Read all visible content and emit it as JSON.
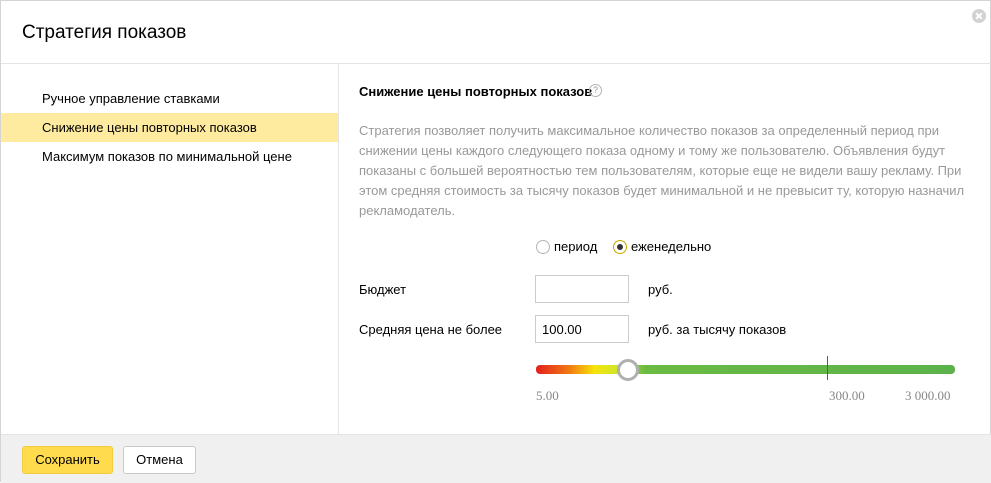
{
  "dialog": {
    "title": "Стратегия показов",
    "close_icon": "close-icon"
  },
  "sidebar": {
    "items": [
      {
        "label": "Ручное управление ставками",
        "active": false
      },
      {
        "label": "Снижение цены повторных показов",
        "active": true
      },
      {
        "label": "Максимум показов по минимальной цене",
        "active": false
      }
    ]
  },
  "content": {
    "section_title": "Снижение цены повторных показов",
    "help_icon": "?",
    "description": "Стратегия позволяет получить максимальное количество показов за определенный период при снижении цены каждого следующего показа одному и тому же пользователю. Объявления будут показаны с большей вероятностью тем пользователям, которые еще не видели вашу рекламу. При этом средняя стоимость за тысячу показов будет минимальной и не превысит ту, которую назначил рекламодатель.",
    "period_options": [
      {
        "label": "период",
        "checked": false
      },
      {
        "label": "еженедельно",
        "checked": true
      }
    ],
    "budget": {
      "label": "Бюджет",
      "value": "",
      "unit": "руб."
    },
    "avg_price": {
      "label": "Средняя цена не более",
      "value": "100.00",
      "unit": "руб. за тысячу показов"
    },
    "slider": {
      "min_label": "5.00",
      "mark_label": "300.00",
      "max_label": "3 000.00",
      "value": 100.0
    }
  },
  "footer": {
    "save_label": "Сохранить",
    "cancel_label": "Отмена"
  },
  "colors": {
    "accent": "#ffdb4d",
    "active_item": "#ffeba0",
    "muted_text": "#999999"
  }
}
